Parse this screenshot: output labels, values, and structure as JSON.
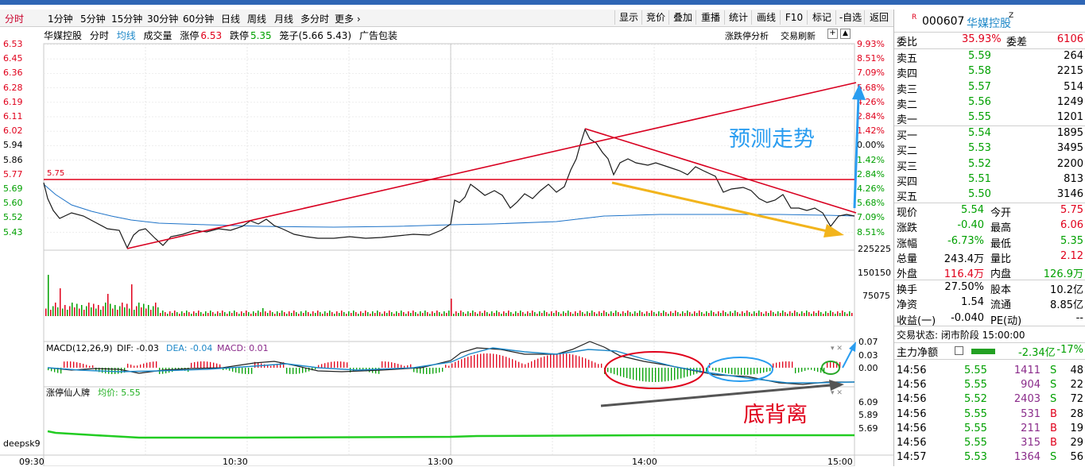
{
  "toolbar": {
    "periods": [
      "分时",
      "1分钟",
      "5分钟",
      "15分钟",
      "30分钟",
      "60分钟",
      "日线",
      "周线",
      "月线",
      "多分时",
      "更多 ›"
    ],
    "buttons": [
      "显示",
      "竞价",
      "叠加",
      "重播",
      "统计",
      "画线",
      "F10",
      "标记",
      "-自选",
      "返回"
    ]
  },
  "chart_header": {
    "name": "华媒控股",
    "mode": "分时",
    "avg_label": "均线",
    "vol_label": "成交量",
    "limit_up_label": "涨停",
    "limit_up": "6.53",
    "limit_down_label": "跌停",
    "limit_down": "5.35",
    "box_label": "笼子(5.66 5.43)",
    "sector": "广告包装",
    "right_link1": "涨跌停分析",
    "right_link2": "交易刷新"
  },
  "price_axis_left": [
    "6.53",
    "6.45",
    "6.36",
    "6.28",
    "6.19",
    "6.11",
    "6.02",
    "5.94",
    "5.86",
    "5.77",
    "5.69",
    "5.60",
    "5.52",
    "5.43"
  ],
  "pct_axis_right": [
    "9.93%",
    "8.51%",
    "7.09%",
    "5.68%",
    "4.26%",
    "2.84%",
    "1.42%",
    "0.00%",
    "1.42%",
    "2.84%",
    "4.26%",
    "5.68%",
    "7.09%",
    "8.51%"
  ],
  "ref_line_label": "5.75",
  "volume_axis": [
    "225225",
    "150150",
    "75075"
  ],
  "macd_header": {
    "label": "MACD(12,26,9)",
    "dif": "DIF: -0.03",
    "dea": "DEA: -0.04",
    "macd": "MACD: 0.01"
  },
  "macd_axis": [
    "0.07",
    "0.03",
    "0.00"
  ],
  "indicator": {
    "name": "涨停仙人牌",
    "avg": "均价: 5.55",
    "axis": [
      "6.09",
      "5.89",
      "5.69"
    ]
  },
  "watermark": "deepsk9",
  "time_axis": [
    "09:30",
    "10:30",
    "13:00",
    "14:00",
    "15:00"
  ],
  "annotations": {
    "forecast": "预测走势",
    "divergence": "底背离"
  },
  "colors": {
    "up": "#e0001b",
    "down": "#00a000",
    "accent": "#1e88c8",
    "price_line": "#1a1a1a",
    "avg_line": "#1e73c8"
  },
  "stock": {
    "code": "000607",
    "name": "华媒控股",
    "badge": "R",
    "super": "Z"
  },
  "order_ratio": {
    "label": "委比",
    "value": "35.93%",
    "diff_label": "委差",
    "diff": "6106"
  },
  "asks": [
    {
      "label": "卖五",
      "price": "5.59",
      "vol": "264"
    },
    {
      "label": "卖四",
      "price": "5.58",
      "vol": "2215"
    },
    {
      "label": "卖三",
      "price": "5.57",
      "vol": "514"
    },
    {
      "label": "卖二",
      "price": "5.56",
      "vol": "1249"
    },
    {
      "label": "卖一",
      "price": "5.55",
      "vol": "1201"
    }
  ],
  "bids": [
    {
      "label": "买一",
      "price": "5.54",
      "vol": "1895"
    },
    {
      "label": "买二",
      "price": "5.53",
      "vol": "3495"
    },
    {
      "label": "买三",
      "price": "5.52",
      "vol": "2200"
    },
    {
      "label": "买四",
      "price": "5.51",
      "vol": "813"
    },
    {
      "label": "买五",
      "price": "5.50",
      "vol": "3146"
    }
  ],
  "stats": [
    {
      "l1": "现价",
      "v1": "5.54",
      "l2": "今开",
      "v2": "5.75"
    },
    {
      "l1": "涨跌",
      "v1": "-0.40",
      "l2": "最高",
      "v2": "6.06"
    },
    {
      "l1": "涨幅",
      "v1": "-6.73%",
      "l2": "最低",
      "v2": "5.35"
    },
    {
      "l1": "总量",
      "v1": "243.4万",
      "l2": "量比",
      "v2": "2.12"
    },
    {
      "l1": "外盘",
      "v1": "116.4万",
      "l2": "内盘",
      "v2": "126.9万"
    }
  ],
  "stats2": [
    {
      "l1": "换手",
      "v1": "27.50%",
      "l2": "股本",
      "v2": "10.2亿"
    },
    {
      "l1": "净资",
      "v1": "1.54",
      "l2": "流通",
      "v2": "8.85亿"
    },
    {
      "l1": "收益(一)",
      "v1": "-0.040",
      "l2": "PE(动)",
      "v2": "--"
    }
  ],
  "trade_status": "交易状态: 闭市阶段 15:00:00",
  "capital_flow": {
    "label": "主力净额",
    "value": "-2.34亿",
    "pct": "-17%"
  },
  "ticks": [
    {
      "time": "14:56",
      "price": "5.55",
      "vol": "1411",
      "side": "S",
      "n": "48"
    },
    {
      "time": "14:56",
      "price": "5.55",
      "vol": "904",
      "side": "S",
      "n": "22"
    },
    {
      "time": "14:56",
      "price": "5.52",
      "vol": "2403",
      "side": "S",
      "n": "72"
    },
    {
      "time": "14:56",
      "price": "5.55",
      "vol": "531",
      "side": "B",
      "n": "28"
    },
    {
      "time": "14:56",
      "price": "5.55",
      "vol": "211",
      "side": "B",
      "n": "19"
    },
    {
      "time": "14:56",
      "price": "5.55",
      "vol": "315",
      "side": "B",
      "n": "29"
    },
    {
      "time": "14:57",
      "price": "5.53",
      "vol": "1364",
      "side": "S",
      "n": "56"
    }
  ]
}
